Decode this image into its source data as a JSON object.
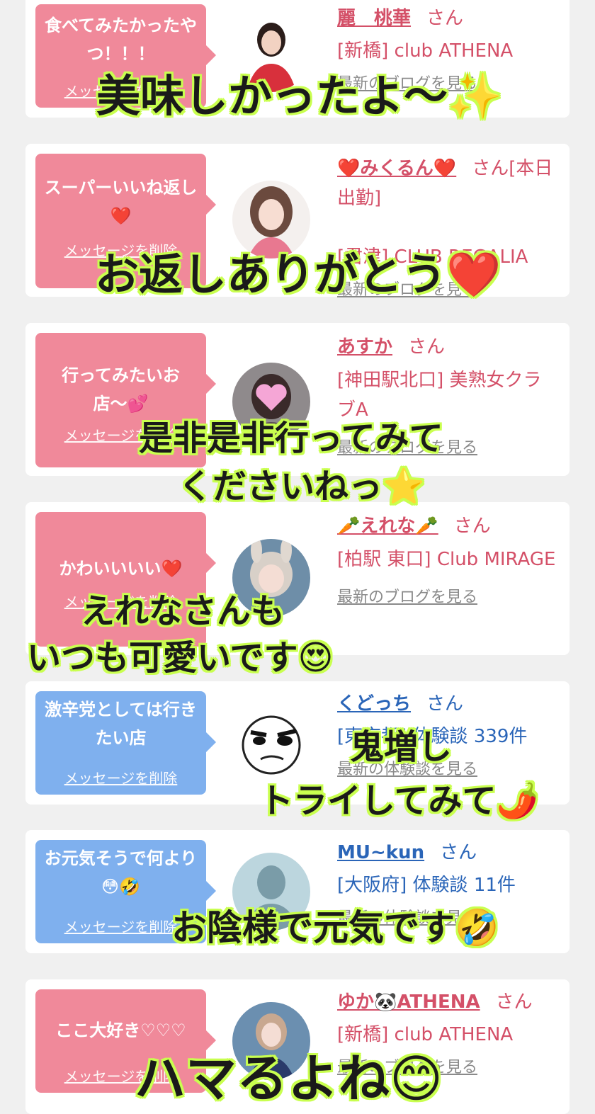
{
  "cards": [
    {
      "bubble_color": "pink",
      "message": "食べてみたかったやつ！！！",
      "delete_label": "メッセージを削除",
      "name": "麗　桃華",
      "san": "さん",
      "store": "[新橋] club ATHENA",
      "link": "最新のブログを見る",
      "avatar": "woman-in-red-photo-icon"
    },
    {
      "bubble_color": "pink",
      "message": "スーパーいいね返し❤️",
      "delete_label": "メッセージを削除",
      "name": "❤️みくるん❤️",
      "san": "さん[本日出勤]",
      "store": "[君津] CLUB REGALIA",
      "link": "最新のブログを見る",
      "avatar": "woman-portrait-icon"
    },
    {
      "bubble_color": "pink",
      "message": "行ってみたいお店〜💕",
      "delete_label": "メッセージを削除",
      "name": "あすか",
      "san": "さん",
      "store": "[神田駅北口] 美熟女クラブA",
      "link": "最新のブログを見る",
      "avatar": "woman-heart-sticker-icon"
    },
    {
      "bubble_color": "pink",
      "message": "かわいいいい❤️",
      "delete_label": "メッセージを削除",
      "name": "🥕えれな🥕",
      "san": "さん",
      "store": "[柏駅 東口] Club MIRAGE",
      "link": "最新のブログを見る",
      "avatar": "woman-bunny-ears-icon"
    },
    {
      "bubble_color": "blue",
      "message": "激辛党としては行きたい店",
      "delete_label": "メッセージを削除",
      "name": "くどっち",
      "san": "さん",
      "store": "[東京都] 体験談 339件",
      "link": "最新の体験談を見る",
      "avatar": "cartoon-face-icon"
    },
    {
      "bubble_color": "blue",
      "message": "お元気そうで何より😳🤣",
      "delete_label": "メッセージを削除",
      "name": "MU~kun",
      "san": "さん",
      "store": "[大阪府] 体験談 11件",
      "link": "最新の体験談を見る",
      "avatar": "silhouette-avatar-icon"
    },
    {
      "bubble_color": "pink",
      "message": "ここ大好き♡♡♡",
      "delete_label": "メッセージを削除",
      "name": "ゆか🐼ATHENA",
      "san": "さん",
      "store": "[新橋] club ATHENA",
      "link": "最新のブログを見る",
      "avatar": "woman-photo-icon"
    }
  ],
  "captions": [
    "美味しかったよ〜✨",
    "お返しありがとう❤️",
    "是非是非行ってみて",
    "くださいねっ⭐️",
    "えれなさんも",
    "いつも可愛いです😍",
    "鬼増し",
    "トライしてみて🌶️",
    "お陰様で元気です🤣",
    "ハマるよね😊"
  ]
}
